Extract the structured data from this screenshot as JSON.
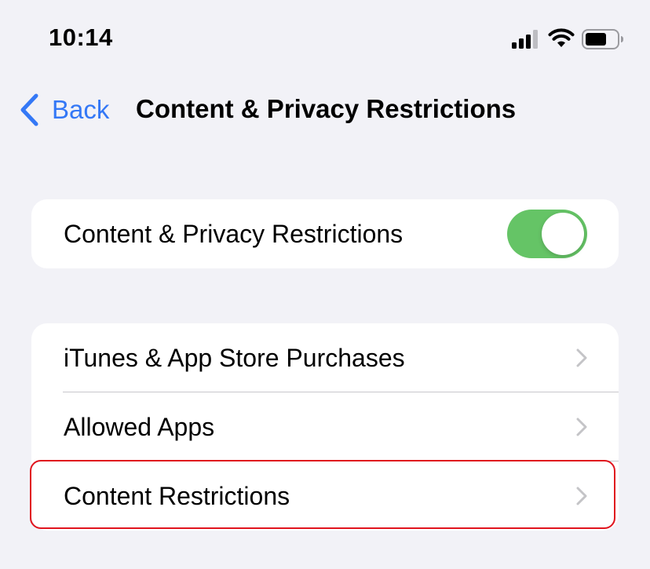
{
  "status_bar": {
    "time": "10:14",
    "signal_icon": "cellular-signal-icon",
    "wifi_icon": "wifi-icon",
    "battery_icon": "battery-icon"
  },
  "nav": {
    "back_label": "Back",
    "title": "Content & Privacy Restrictions"
  },
  "main_toggle": {
    "label": "Content & Privacy Restrictions",
    "enabled": true,
    "on_color": "#65c466"
  },
  "menu": {
    "items": [
      {
        "label": "iTunes & App Store Purchases"
      },
      {
        "label": "Allowed Apps"
      },
      {
        "label": "Content Restrictions",
        "highlighted": true
      }
    ]
  },
  "colors": {
    "accent": "#3478f6",
    "background": "#f2f2f7",
    "highlight": "#e0141e"
  }
}
